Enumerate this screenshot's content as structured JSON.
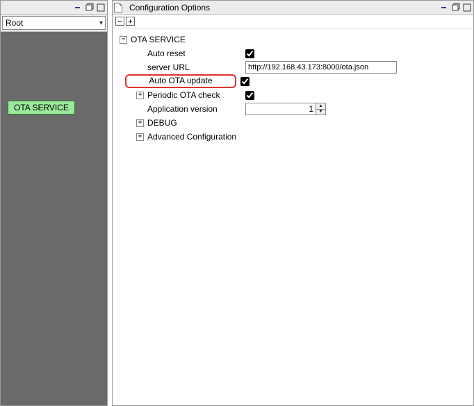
{
  "leftPane": {
    "dropdown": "Root",
    "serviceTag": "OTA SERVICE"
  },
  "rightPane": {
    "title": "Configuration Options",
    "tree": {
      "rootLabel": "OTA SERVICE",
      "autoReset": {
        "label": "Auto reset",
        "checked": true
      },
      "serverUrl": {
        "label": "server URL",
        "value": "http://192.168.43.173:8000/ota.json"
      },
      "autoOtaUpdate": {
        "label": "Auto OTA update",
        "checked": true
      },
      "periodicCheck": {
        "label": "Periodic OTA check",
        "checked": true
      },
      "appVersion": {
        "label": "Application version",
        "value": "1"
      },
      "debug": {
        "label": "DEBUG"
      },
      "advanced": {
        "label": "Advanced Configuration"
      }
    }
  }
}
